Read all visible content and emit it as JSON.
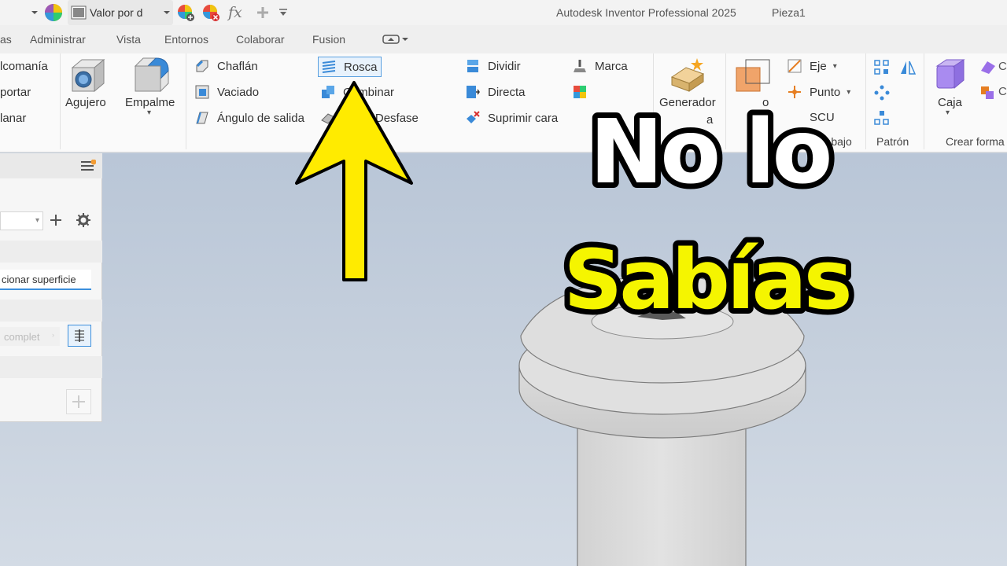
{
  "quick_access": {
    "appearance_value": "Valor por d",
    "fx_label": "fx"
  },
  "title_bar": {
    "app_name": "Autodesk Inventor Professional 2025",
    "document": "Pieza1"
  },
  "menu_tabs": [
    {
      "label": "as"
    },
    {
      "label": "Administrar"
    },
    {
      "label": "Vista"
    },
    {
      "label": "Entornos"
    },
    {
      "label": "Colaborar"
    },
    {
      "label": "Fusion"
    }
  ],
  "ribbon": {
    "left_partial": [
      "lcomanía",
      "portar",
      "lanar"
    ],
    "agujero": "Agujero",
    "empalme": "Empalme",
    "chaflan": "Chaflán",
    "vaciado": "Vaciado",
    "angulo": "Ángulo de salida",
    "rosca": "Rosca",
    "combinar": "Combinar",
    "desfase": "sado/ Desfase",
    "dividir": "Dividir",
    "directa": "Directa",
    "suprimir": "Suprimir cara",
    "marca": "Marca",
    "generador_1": "Generador",
    "generador_2": "a",
    "eje": "Eje",
    "punto": "Punto",
    "scu": "SCU",
    "trabajo": "trabajo",
    "patron": "Patrón",
    "caja": "Caja",
    "crear_forma": "Crear forma",
    "plano_partial": "o"
  },
  "panel": {
    "select_surface": "cionar superficie",
    "complet": "complet"
  },
  "overlay": {
    "line1": "No lo",
    "line2": "Sabías",
    "line1_color": "#ffffff",
    "line2_color": "#f5f500",
    "outline_color": "#000000",
    "arrow_color": "#ffeb00"
  },
  "accent": "#3c8fdc"
}
